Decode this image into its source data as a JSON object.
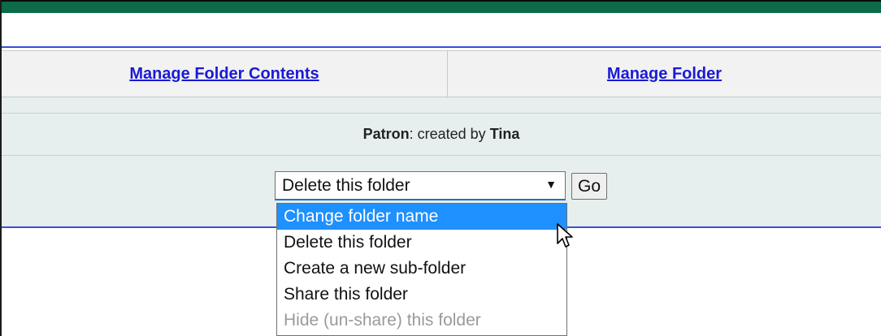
{
  "tabs": {
    "manage_contents": "Manage Folder Contents",
    "manage_folder": "Manage Folder"
  },
  "info": {
    "folder_name": "Patron",
    "created_by_text": ": created by ",
    "owner": "Tina"
  },
  "action": {
    "selected_value": "Delete this folder",
    "go_label": "Go",
    "options": [
      {
        "label": "Change folder name",
        "state": "highlighted"
      },
      {
        "label": "Delete this folder",
        "state": "normal"
      },
      {
        "label": "Create a new sub-folder",
        "state": "normal"
      },
      {
        "label": "Share this folder",
        "state": "normal"
      },
      {
        "label": "Hide (un-share) this folder",
        "state": "disabled"
      }
    ]
  },
  "colors": {
    "header_bar": "#0d6b47",
    "link": "#1a1ad6",
    "highlight": "#1e90ff",
    "divider_line": "#3a4fd6",
    "panel_background": "#e6eeee"
  },
  "icons": {
    "select_arrow": "dropdown-arrow-icon",
    "pointer": "mouse-pointer-icon"
  }
}
